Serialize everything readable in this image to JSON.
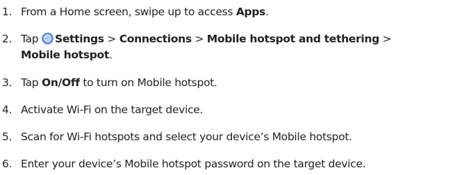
{
  "steps": [
    {
      "number": "1.",
      "parts": [
        "From a Home screen, swipe up to access ",
        "Apps",
        "."
      ]
    },
    {
      "number": "2.",
      "parts": [
        "Tap ",
        "Settings",
        " > ",
        "Connections",
        " > ",
        "Mobile hotspot and tethering",
        " >",
        "Mobile hotspot",
        "."
      ],
      "icon": "settings-gear-icon"
    },
    {
      "number": "3.",
      "parts": [
        "Tap ",
        "On/Off",
        " to turn on Mobile hotspot."
      ]
    },
    {
      "number": "4.",
      "parts": [
        "Activate Wi-Fi on the target device."
      ]
    },
    {
      "number": "5.",
      "parts": [
        "Scan for Wi-Fi hotspots and select your device’s Mobile hotspot."
      ]
    },
    {
      "number": "6.",
      "parts": [
        "Enter your device’s Mobile hotspot password on the target device."
      ]
    }
  ],
  "colors": {
    "text": "#231f20",
    "settings_icon_bg": "#6c8ee8"
  }
}
